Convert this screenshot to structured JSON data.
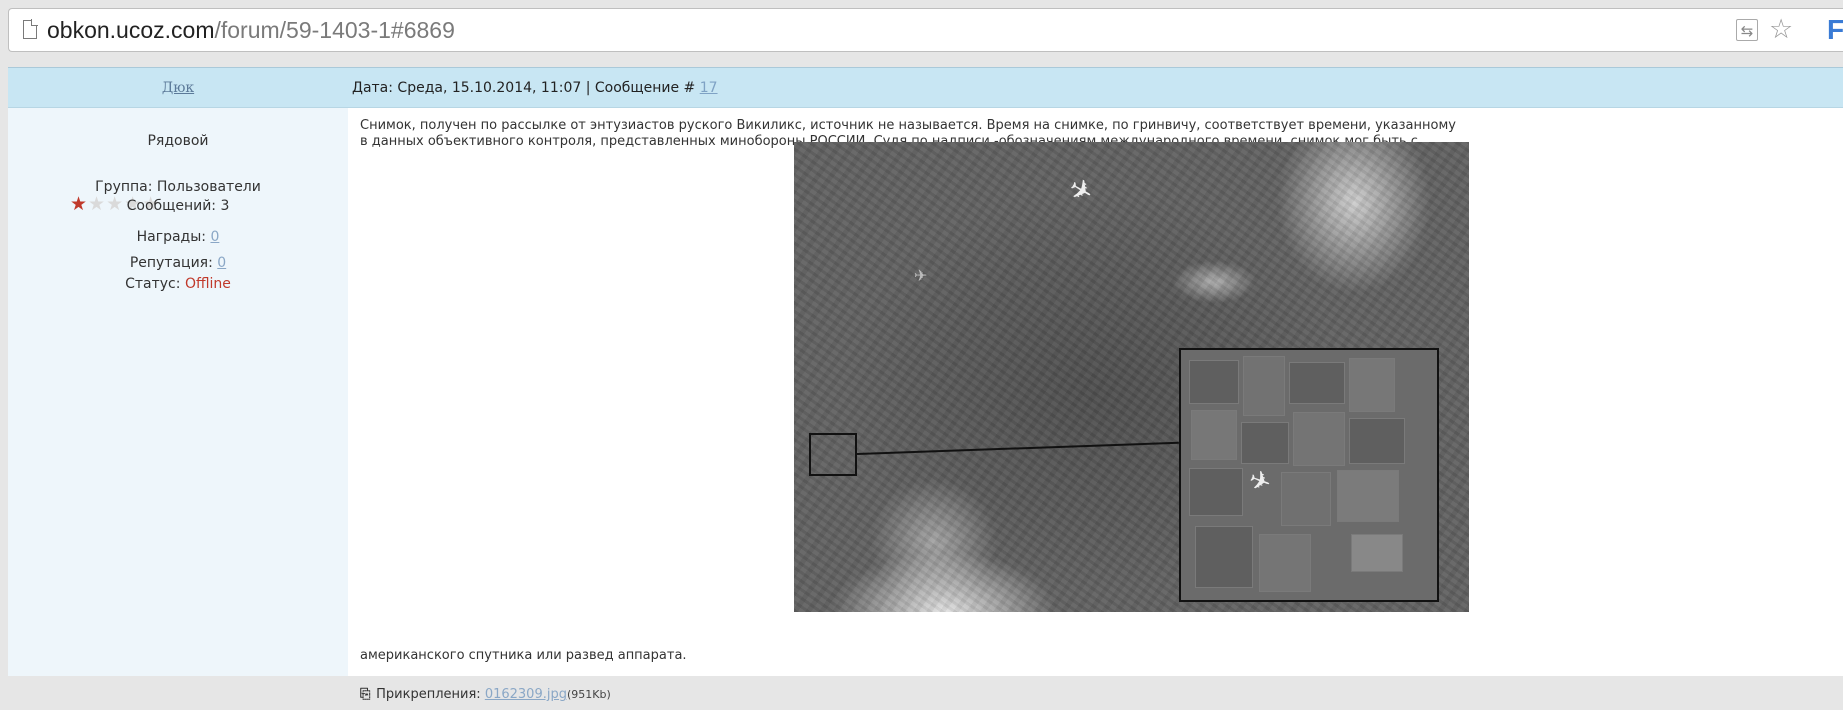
{
  "browser": {
    "url_host": "obkon.ucoz.com",
    "url_path": "/forum/59-1403-1#6869"
  },
  "post": {
    "author": "Дюк",
    "meta_prefix": "Дата: Среда, 15.10.2014, 11:07 | Сообщение # ",
    "message_number": "17",
    "user": {
      "rank": "Рядовой",
      "rating_stars": 1,
      "rating_max": 5,
      "group": "Группа: Пользователи",
      "messages": "Сообщений: 3",
      "awards_label": "Награды: ",
      "awards_value": "0",
      "reputation_label": "Репутация: ",
      "reputation_value": "0",
      "status_label": "Статус: ",
      "status_value": "Offline"
    },
    "text_line1": "Снимок, получен по рассылке от энтузиастов руского Викиликс, источник не называется. Время на снимке, по гринвичу, соответствует времени, указанному",
    "text_line2": "в данных объективного контроля, представленных минобороны РОССИИ. Судя по надписи -обозначениям международного времени, снимок мог быть с",
    "text_end": "американского спутника или развед аппарата.",
    "attachment_label": "Прикрепления: ",
    "attachment_file": "0162309.jpg",
    "attachment_size": "(951Kb)"
  },
  "colors": {
    "header_bg": "#c8e6f3",
    "sidebar_bg": "#eef6fb",
    "link": "#8aa7c6",
    "offline": "#c0392b"
  }
}
